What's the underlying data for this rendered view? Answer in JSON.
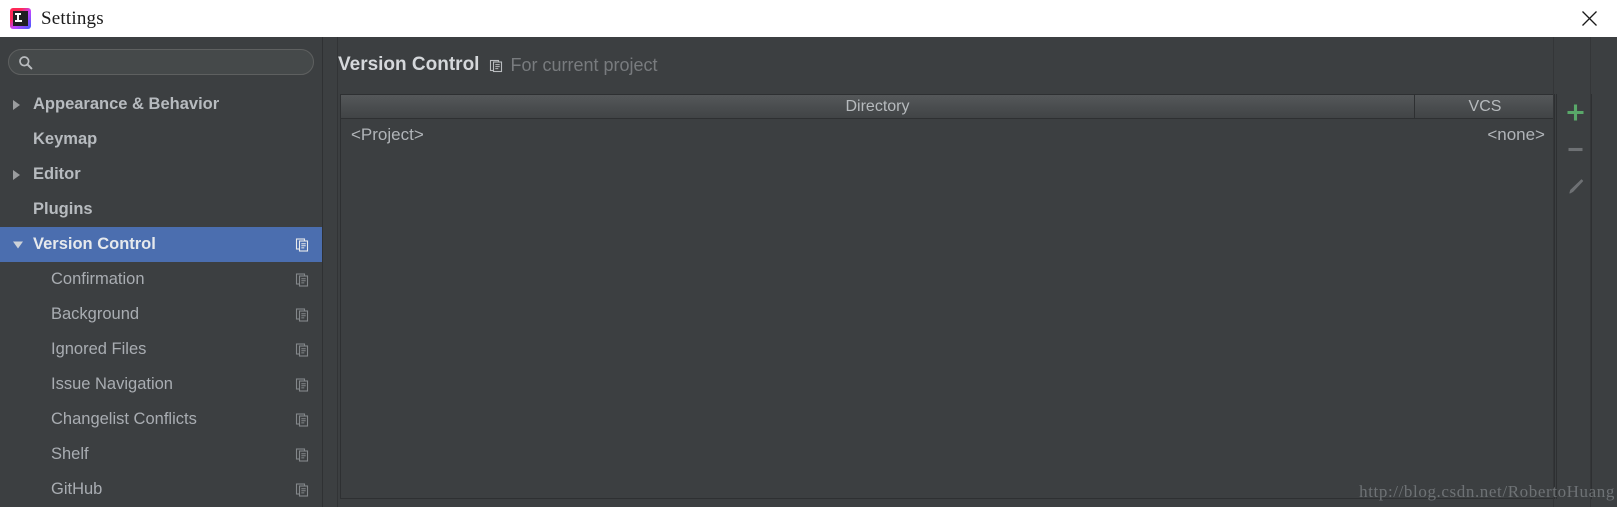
{
  "titlebar": {
    "app_icon": "intellij-idea-icon",
    "title": "Settings",
    "close_label": "close-icon"
  },
  "sidebar": {
    "search": {
      "icon": "search-icon",
      "value": "",
      "placeholder": ""
    },
    "items": [
      {
        "label": "Appearance & Behavior",
        "level": "top",
        "expander": "right",
        "selected": false,
        "scope_icon": false
      },
      {
        "label": "Keymap",
        "level": "top",
        "expander": "none",
        "selected": false,
        "scope_icon": false
      },
      {
        "label": "Editor",
        "level": "top",
        "expander": "right",
        "selected": false,
        "scope_icon": false
      },
      {
        "label": "Plugins",
        "level": "top",
        "expander": "none",
        "selected": false,
        "scope_icon": false
      },
      {
        "label": "Version Control",
        "level": "top",
        "expander": "down",
        "selected": true,
        "scope_icon": true
      },
      {
        "label": "Confirmation",
        "level": "child",
        "expander": "none",
        "selected": false,
        "scope_icon": true
      },
      {
        "label": "Background",
        "level": "child",
        "expander": "none",
        "selected": false,
        "scope_icon": true
      },
      {
        "label": "Ignored Files",
        "level": "child",
        "expander": "none",
        "selected": false,
        "scope_icon": true
      },
      {
        "label": "Issue Navigation",
        "level": "child",
        "expander": "none",
        "selected": false,
        "scope_icon": true
      },
      {
        "label": "Changelist Conflicts",
        "level": "child",
        "expander": "none",
        "selected": false,
        "scope_icon": true
      },
      {
        "label": "Shelf",
        "level": "child",
        "expander": "none",
        "selected": false,
        "scope_icon": true
      },
      {
        "label": "GitHub",
        "level": "child",
        "expander": "none",
        "selected": false,
        "scope_icon": true
      }
    ]
  },
  "main": {
    "title": "Version Control",
    "scope_icon": "for-current-project-icon",
    "subtitle": "For current project",
    "table": {
      "columns": [
        "Directory",
        "VCS"
      ],
      "rows": [
        {
          "directory": "<Project>",
          "vcs": "<none>"
        }
      ]
    },
    "toolbar": [
      {
        "name": "add-button",
        "glyph": "+",
        "color": "#59a869",
        "enabled": true
      },
      {
        "name": "remove-button",
        "glyph": "-",
        "color": "#6e7174",
        "enabled": false
      },
      {
        "name": "edit-button",
        "glyph": "pencil",
        "color": "#6e7174",
        "enabled": false
      }
    ]
  },
  "watermark": "http://blog.csdn.net/RobertoHuang",
  "colors": {
    "window_bg": "#3c3f41",
    "titlebar_bg": "#ffffff",
    "selection_blue": "#4b6eaf",
    "text_primary": "#b7bbbf",
    "text_muted": "#787b7e",
    "add_green": "#59a869"
  }
}
